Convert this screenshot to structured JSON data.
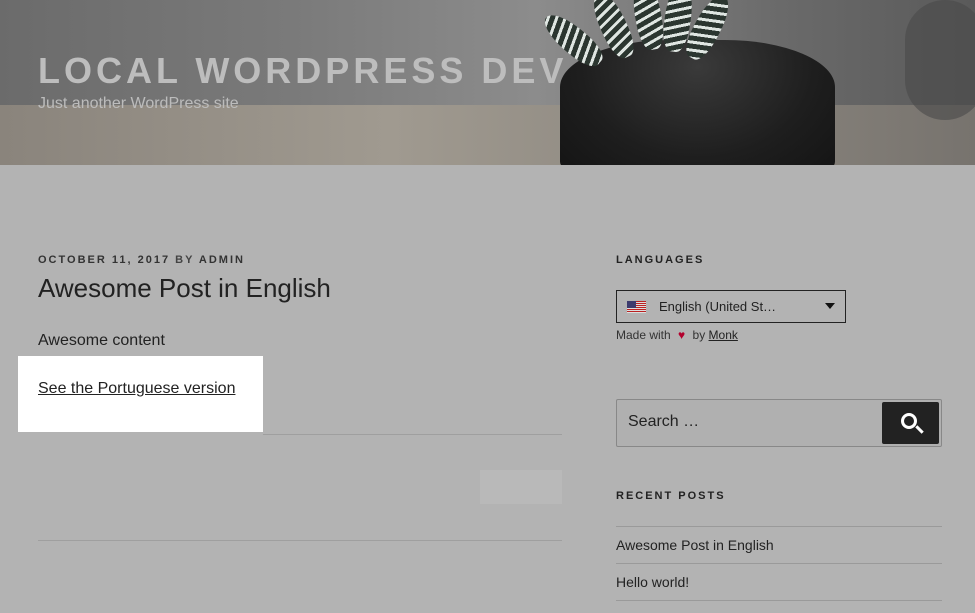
{
  "header": {
    "site_title": "LOCAL WORDPRESS DEV",
    "tagline": "Just another WordPress site"
  },
  "post": {
    "date": "OCTOBER 11, 2017",
    "by_label": "BY",
    "author": "ADMIN",
    "title": "Awesome Post in English",
    "content": "Awesome content",
    "translation_link": "See the Portuguese version"
  },
  "sidebar": {
    "languages": {
      "title": "LANGUAGES",
      "selected": "English (United St…",
      "made_with": "Made with",
      "heart": "♥",
      "by": "by",
      "monk": "Monk"
    },
    "search": {
      "placeholder": "Search …"
    },
    "recent_posts": {
      "title": "RECENT POSTS",
      "items": [
        "Awesome Post in English",
        "Hello world!"
      ]
    }
  },
  "colors": {
    "overlay": "#b3b3b3",
    "button_dark": "#222222",
    "heart": "#b3002d"
  }
}
